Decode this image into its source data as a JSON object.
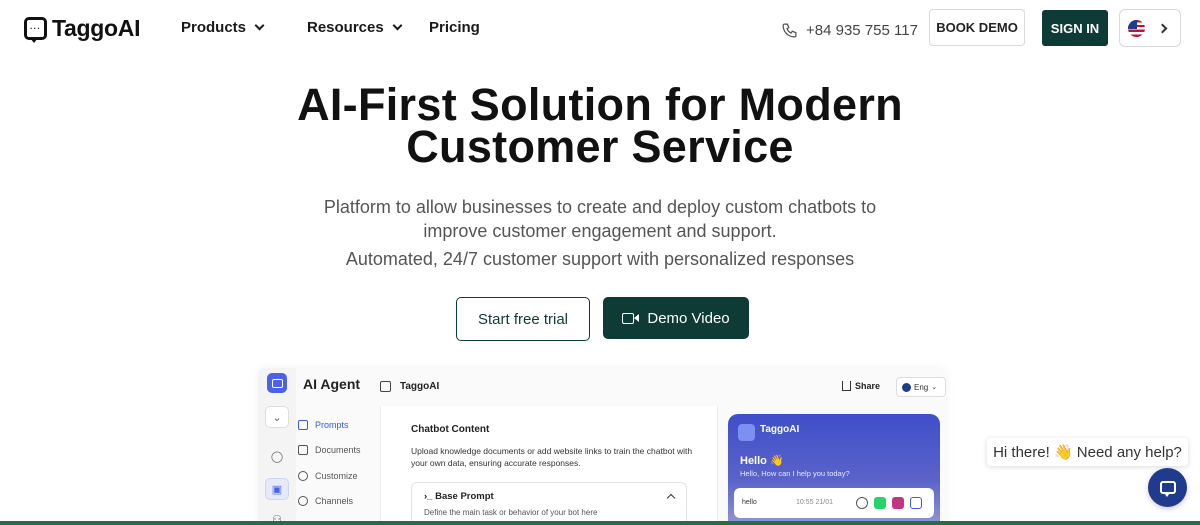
{
  "brand": {
    "name": "TaggoAI"
  },
  "nav": {
    "products": "Products",
    "resources": "Resources",
    "pricing": "Pricing",
    "phone": "+84 935 755 117",
    "book_demo": "BOOK DEMO",
    "sign_in": "SIGN IN"
  },
  "hero": {
    "title_line1": "AI-First Solution for Modern",
    "title_line2": "Customer Service",
    "subtitle_line1": "Platform to allow businesses to create and deploy custom chatbots to",
    "subtitle_line2": "improve customer engagement and support.",
    "subtitle_line3": "Automated, 24/7 customer support with personalized responses",
    "cta_trial": "Start free trial",
    "cta_video": "Demo Video"
  },
  "preview": {
    "title": "AI Agent",
    "menu": [
      {
        "label": "Prompts",
        "icon": "prompts-icon",
        "active": true
      },
      {
        "label": "Documents",
        "icon": "documents-icon",
        "active": false
      },
      {
        "label": "Customize",
        "icon": "customize-icon",
        "active": false
      },
      {
        "label": "Channels",
        "icon": "channels-icon",
        "active": false
      }
    ],
    "agent_name": "TaggoAI",
    "share": "Share",
    "lang": "Eng",
    "content_heading": "Chatbot Content",
    "content_desc": "Upload knowledge documents or add website links to train the chatbot with your own data, ensuring accurate responses.",
    "base_prompt_title": "Base Prompt",
    "base_prompt_desc": "Define the main task or behavior of your bot here",
    "chat": {
      "name": "TaggoAI",
      "hello": "Hello 👋",
      "help": "Hello, How can I help you today?",
      "message": "hello",
      "time": "10:55 21/01"
    }
  },
  "help_widget": {
    "text": "Hi there! 👋 Need any help?"
  },
  "colors": {
    "primary": "#0e3b36",
    "accent": "#1f3b8c",
    "chat_gradient": "#3f4fc9"
  }
}
